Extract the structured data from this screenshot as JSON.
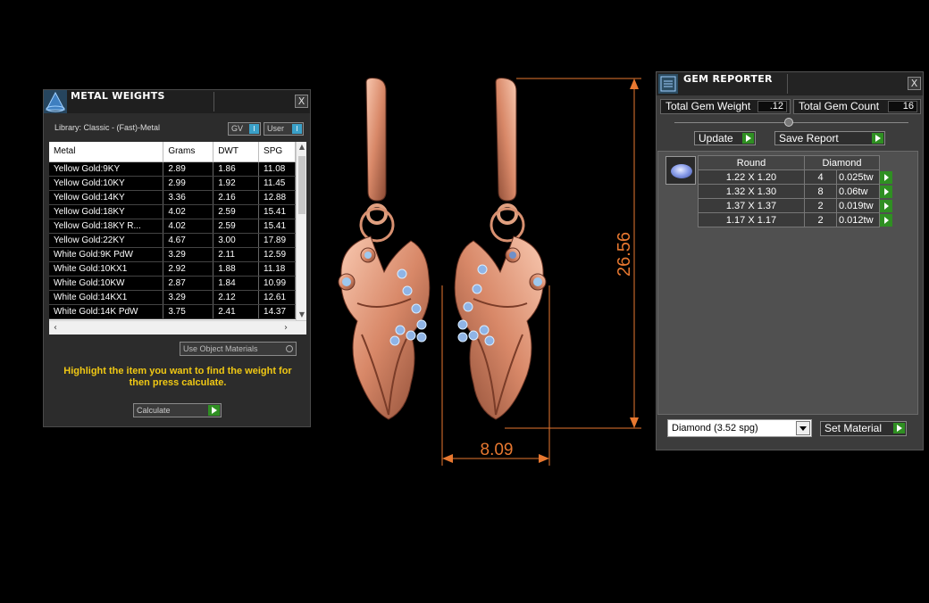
{
  "metal_weights": {
    "title": "METAL WEIGHTS",
    "close": "X",
    "library": "Library: Classic - (Fast)-Metal",
    "gv_label": "GV",
    "user_label": "User",
    "toggle_mark": "I",
    "columns": [
      "Metal",
      "Grams",
      "DWT",
      "SPG"
    ],
    "rows": [
      [
        "Yellow Gold:9KY",
        "2.89",
        "1.86",
        "11.08"
      ],
      [
        "Yellow Gold:10KY",
        "2.99",
        "1.92",
        "11.45"
      ],
      [
        "Yellow Gold:14KY",
        "3.36",
        "2.16",
        "12.88"
      ],
      [
        "Yellow Gold:18KY",
        "4.02",
        "2.59",
        "15.41"
      ],
      [
        "Yellow Gold:18KY R...",
        "4.02",
        "2.59",
        "15.41"
      ],
      [
        "Yellow Gold:22KY",
        "4.67",
        "3.00",
        "17.89"
      ],
      [
        "White Gold:9K PdW",
        "3.29",
        "2.11",
        "12.59"
      ],
      [
        "White Gold:10KX1",
        "2.92",
        "1.88",
        "11.18"
      ],
      [
        "White Gold:10KW",
        "2.87",
        "1.84",
        "10.99"
      ],
      [
        "White Gold:14KX1",
        "3.29",
        "2.12",
        "12.61"
      ],
      [
        "White Gold:14K PdW",
        "3.75",
        "2.41",
        "14.37"
      ]
    ],
    "use_object_materials": "Use Object Materials",
    "instructions": "Highlight the item you want to find the weight for then press calculate.",
    "calculate": "Calculate"
  },
  "dimensions": {
    "height": "26.56",
    "width": "8.09"
  },
  "gem_reporter": {
    "title": "GEM REPORTER",
    "close": "X",
    "total_gem_weight_label": "Total Gem Weight",
    "total_gem_weight": ".12",
    "total_gem_count_label": "Total Gem Count",
    "total_gem_count": "16",
    "update": "Update",
    "save_report": "Save Report",
    "shape_header": "Round",
    "material_header": "Diamond",
    "rows": [
      {
        "size": "1.22 X 1.20",
        "count": "4",
        "weight": "0.025tw"
      },
      {
        "size": "1.32 X 1.30",
        "count": "8",
        "weight": "0.06tw"
      },
      {
        "size": "1.37 X 1.37",
        "count": "2",
        "weight": "0.019tw"
      },
      {
        "size": "1.17 X 1.17",
        "count": "2",
        "weight": "0.012tw"
      }
    ],
    "material_select": "Diamond    (3.52 spg)",
    "set_material": "Set Material"
  },
  "colors": {
    "metal": "#e8a080",
    "dimension_line": "#e87830",
    "instructions": "#f0c814",
    "go_button": "#2f8f22",
    "gem": "#8fb4e6"
  }
}
